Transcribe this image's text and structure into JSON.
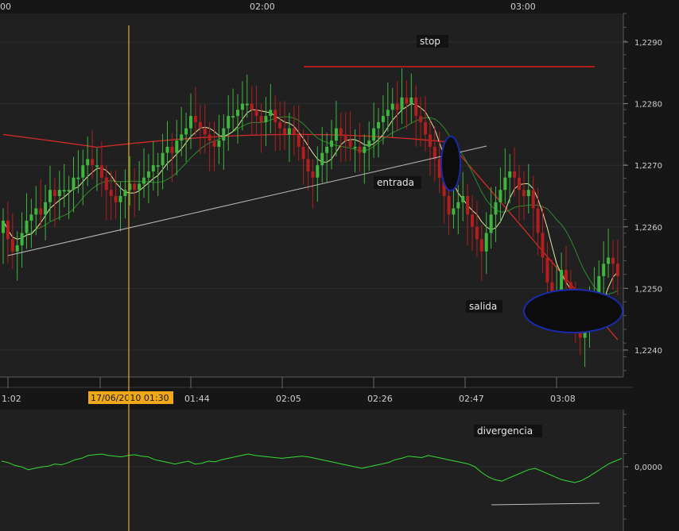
{
  "top_time_labels": [
    "00",
    "02:00",
    "03:00"
  ],
  "price_axis": {
    "ticks": [
      "1,2290",
      "1,2280",
      "1,2270",
      "1,2260",
      "1,2250",
      "1,2240"
    ]
  },
  "time_axis": {
    "labels": [
      "1:02",
      "01:44",
      "02:05",
      "02:26",
      "02:47",
      "03:08"
    ],
    "cursor_label": "17/06/2010 01:30"
  },
  "osc_axis": {
    "ticks": [
      "0,0000"
    ]
  },
  "annotations": {
    "stop": "stop",
    "entrada": "entrada",
    "salida": "salida",
    "divergencia": "divergencia"
  },
  "colors": {
    "background": "#161616",
    "panel": "#202020",
    "grid": "#2e2e2e",
    "bull_candle": "#3fb63f",
    "bear_candle": "#b41e1e",
    "ma_fast": "#e6e6a0",
    "ma_mid": "#2e8b2e",
    "ma_slow": "#d42a2a",
    "trendline": "#bdbdbd",
    "stop_line": "#e01a1a",
    "cursor": "#e6a817",
    "oscillator": "#33dd33",
    "ellipse_edge": "#1a2aa8"
  },
  "chart_data": [
    {
      "type": "candlestick",
      "ylim": [
        1.2235,
        1.2295
      ],
      "time_ticks": [
        "1:02",
        "01:44",
        "02:05",
        "02:26",
        "02:47",
        "03:08"
      ],
      "cursor_time": "17/06/2010 01:30",
      "stop_level": 1.2285,
      "close": [
        1.2261,
        1.2258,
        1.2256,
        1.2257,
        1.2259,
        1.2261,
        1.2262,
        1.2263,
        1.2262,
        1.2264,
        1.2266,
        1.2265,
        1.2266,
        1.2266,
        1.2266,
        1.2268,
        1.2268,
        1.227,
        1.2271,
        1.227,
        1.227,
        1.2268,
        1.2266,
        1.2265,
        1.2264,
        1.2265,
        1.2266,
        1.2267,
        1.2266,
        1.2267,
        1.2268,
        1.2269,
        1.227,
        1.227,
        1.2272,
        1.2273,
        1.2272,
        1.2274,
        1.2275,
        1.2276,
        1.2278,
        1.2277,
        1.2276,
        1.2275,
        1.2274,
        1.2273,
        1.2274,
        1.2276,
        1.2278,
        1.2278,
        1.2279,
        1.228,
        1.228,
        1.2279,
        1.2278,
        1.2277,
        1.2278,
        1.2279,
        1.2277,
        1.2276,
        1.2275,
        1.2276,
        1.2275,
        1.2273,
        1.2271,
        1.2269,
        1.2268,
        1.227,
        1.2272,
        1.2273,
        1.2274,
        1.2276,
        1.2275,
        1.2274,
        1.2273,
        1.2273,
        1.2272,
        1.2273,
        1.2274,
        1.2276,
        1.2277,
        1.2278,
        1.2279,
        1.228,
        1.2279,
        1.2281,
        1.228,
        1.2281,
        1.2278,
        1.2277,
        1.2275,
        1.2273,
        1.2271,
        1.2268,
        1.2265,
        1.2262,
        1.2263,
        1.2264,
        1.2265,
        1.2262,
        1.226,
        1.2258,
        1.2256,
        1.2259,
        1.2262,
        1.2264,
        1.2266,
        1.2268,
        1.2269,
        1.2268,
        1.2266,
        1.2265,
        1.2266,
        1.2263,
        1.2259,
        1.2255,
        1.2251,
        1.2247,
        1.2249,
        1.2253,
        1.2251,
        1.2248,
        1.2245,
        1.2242,
        1.2244,
        1.2247,
        1.2249,
        1.2252,
        1.2254,
        1.2255,
        1.2254,
        1.2252
      ]
    },
    {
      "type": "line",
      "name": "oscillator",
      "zero_level": "0,0000",
      "values": [
        0.5,
        0.4,
        0.2,
        0.1,
        -0.1,
        0.0,
        0.1,
        0.15,
        0.3,
        0.25,
        0.4,
        0.6,
        0.7,
        0.9,
        0.95,
        1.0,
        0.9,
        0.85,
        0.8,
        0.9,
        0.95,
        0.85,
        0.8,
        0.6,
        0.5,
        0.4,
        0.3,
        0.4,
        0.5,
        0.3,
        0.35,
        0.5,
        0.45,
        0.6,
        0.7,
        0.8,
        0.9,
        1.0,
        0.9,
        0.85,
        0.8,
        0.75,
        0.7,
        0.75,
        0.8,
        0.85,
        0.8,
        0.7,
        0.6,
        0.5,
        0.4,
        0.3,
        0.2,
        0.1,
        0.0,
        0.1,
        0.2,
        0.3,
        0.4,
        0.6,
        0.7,
        0.85,
        0.8,
        0.75,
        0.9,
        0.8,
        0.7,
        0.6,
        0.5,
        0.4,
        0.3,
        0.1,
        -0.3,
        -0.6,
        -0.8,
        -0.9,
        -0.7,
        -0.5,
        -0.3,
        -0.1,
        0.0,
        -0.2,
        -0.4,
        -0.6,
        -0.8,
        -0.9,
        -1.0,
        -0.85,
        -0.6,
        -0.3,
        0.0,
        0.3,
        0.5,
        0.7
      ]
    }
  ]
}
